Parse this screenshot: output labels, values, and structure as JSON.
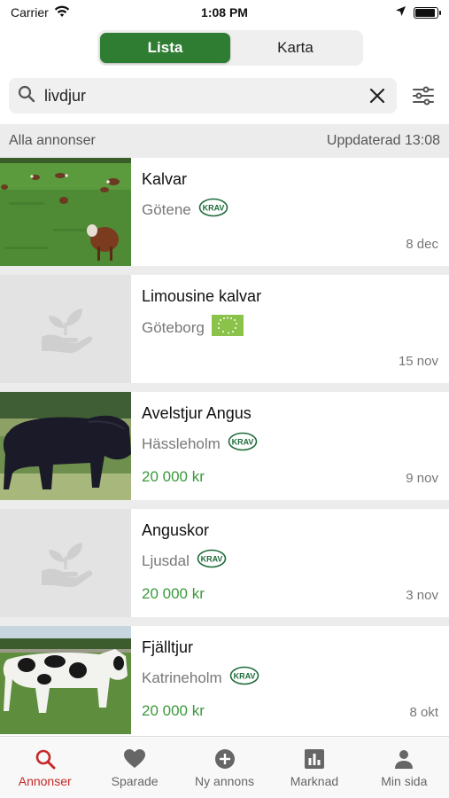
{
  "status_bar": {
    "carrier": "Carrier",
    "time": "1:08 PM",
    "battery_level": 0.9
  },
  "segment": {
    "tabs": [
      {
        "label": "Lista",
        "active": true
      },
      {
        "label": "Karta",
        "active": false
      }
    ]
  },
  "search": {
    "value": "livdjur",
    "placeholder": "Sök"
  },
  "section": {
    "left": "Alla annonser",
    "right": "Uppdaterad 13:08"
  },
  "listings": [
    {
      "title": "Kalvar",
      "location": "Götene",
      "badge": "KRAV",
      "price": "",
      "date": "8 dec",
      "image": "cattle-pasture-photo"
    },
    {
      "title": "Limousine kalvar",
      "location": "Göteborg",
      "badge": "eu-organic-leaf",
      "price": "",
      "date": "15 nov",
      "image": "placeholder"
    },
    {
      "title": "Avelstjur Angus",
      "location": "Hässleholm",
      "badge": "KRAV",
      "price": "20 000 kr",
      "date": "9 nov",
      "image": "black-bull-photo"
    },
    {
      "title": "Anguskor",
      "location": "Ljusdal",
      "badge": "KRAV",
      "price": "20 000 kr",
      "date": "3 nov",
      "image": "placeholder"
    },
    {
      "title": "Fjälltjur",
      "location": "Katrineholm",
      "badge": "KRAV",
      "price": "20 000 kr",
      "date": "8 okt",
      "image": "spotted-bull-photo"
    }
  ],
  "tab_bar": {
    "tabs": [
      {
        "label": "Annonser",
        "icon": "search-icon",
        "active": true
      },
      {
        "label": "Sparade",
        "icon": "heart-icon",
        "active": false
      },
      {
        "label": "Ny annons",
        "icon": "add-circle-icon",
        "active": false
      },
      {
        "label": "Marknad",
        "icon": "bar-chart-icon",
        "active": false
      },
      {
        "label": "Min sida",
        "icon": "person-icon",
        "active": false
      }
    ]
  },
  "colors": {
    "accent_green": "#2e7d32",
    "price_green": "#3a9a3a",
    "active_tab_red": "#c62828"
  }
}
